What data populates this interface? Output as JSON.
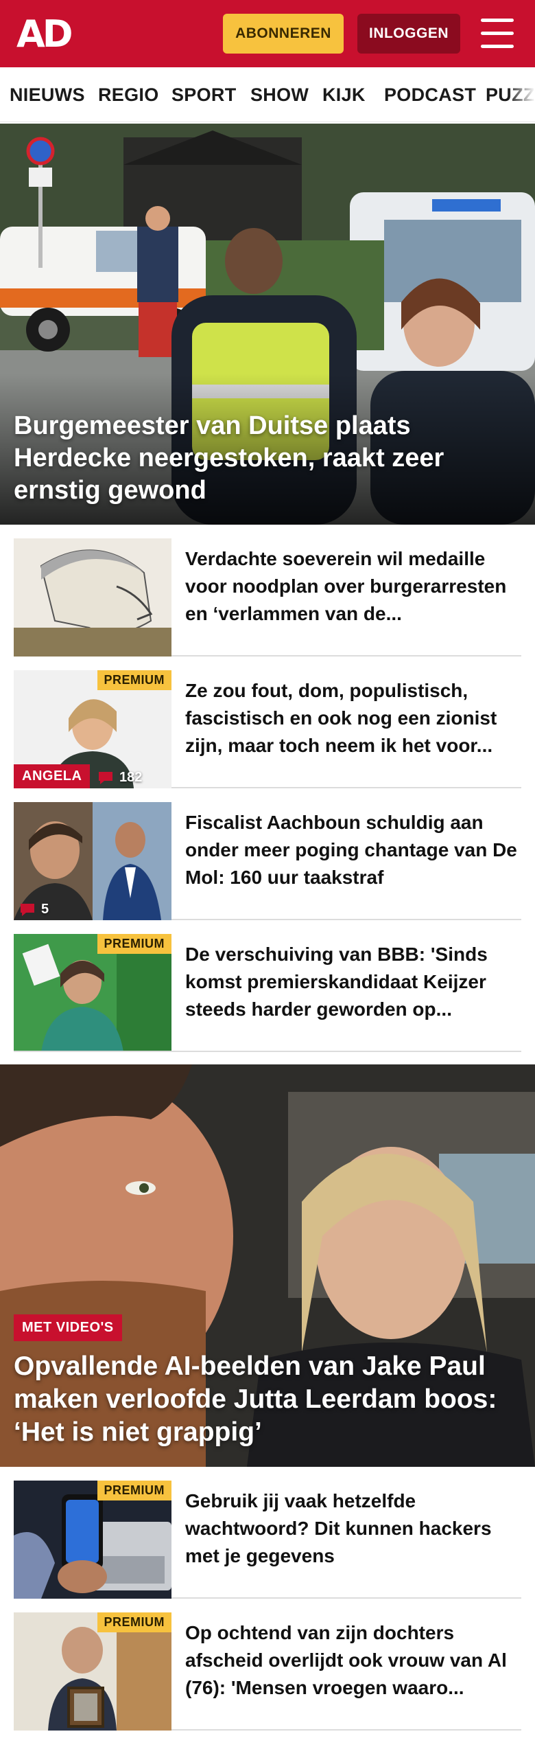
{
  "header": {
    "logo": "AD",
    "subscribe_label": "ABONNEREN",
    "login_label": "INLOGGEN",
    "menu_icon": "hamburger-menu-icon",
    "brand_color": "#c8102e",
    "subscribe_color": "#f7c23e"
  },
  "nav": {
    "items": [
      "NIEUWS",
      "REGIO",
      "SPORT",
      "SHOW",
      "KIJK",
      "PODCAST",
      "PUZZ"
    ]
  },
  "hero": {
    "title": "Burgemeester van Duitse plaats Herdecke neergestoken, raakt zeer ernstig gewond"
  },
  "articles": [
    {
      "title": "Verdachte soeverein wil medaille voor noodplan over burgerarres­ten en ‘verlammen van de...",
      "premium": "",
      "tag": "",
      "comments": ""
    },
    {
      "title": "Ze zou fout, dom, populistisch, fascistisch en ook nog een zionist zijn, maar toch neem ik het voor...",
      "premium": "PREMIUM",
      "tag": "ANGELA",
      "comments": "182"
    },
    {
      "title": "Fiscalist Aachboun schuldig aan onder meer poging chantage van De Mol: 160 uur taakstraf",
      "premium": "",
      "tag": "",
      "comments": "5"
    },
    {
      "title": "De verschuiving van BBB: 'Sinds komst premierskandidaat Keijzer steeds harder geworden op...",
      "premium": "PREMIUM",
      "tag": "",
      "comments": ""
    }
  ],
  "hero2": {
    "tag": "MET VIDEO'S",
    "title": "Opvallende AI-beelden van Jake Paul maken verloofde Jutta Leerdam boos: ‘Het is niet grappig’"
  },
  "articles2": [
    {
      "title": "Gebruik jij vaak hetzelfde wachtwoord? Dit kunnen hackers met je gegevens",
      "premium": "PREMIUM"
    },
    {
      "title": "Op ochtend van zijn dochters afscheid overlijdt ook vrouw van Al (76): 'Mensen vroegen waaro...",
      "premium": "PREMIUM"
    }
  ]
}
